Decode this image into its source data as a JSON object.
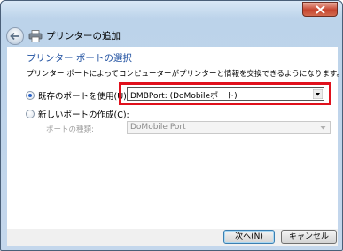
{
  "window": {
    "title": "プリンターの追加",
    "colors": {
      "heading": "#1e4fa0",
      "highlight": "#e0101c",
      "titlebar": "#bcd3ea"
    }
  },
  "page": {
    "heading": "プリンター ポートの選択",
    "description": "プリンター ポートによってコンピューターがプリンターと情報を交換できるようになります。"
  },
  "options": {
    "use_existing": {
      "label": "既存のポートを使用(U):",
      "selected": true,
      "value": "DMBPort: (DoMobileポート)"
    },
    "create_new": {
      "label": "新しいポートの作成(C):",
      "selected": false
    },
    "port_type": {
      "label": "ポートの種類:",
      "value": "DoMobile Port"
    }
  },
  "buttons": {
    "next": "次へ(N)",
    "cancel": "キャンセル"
  },
  "icons": [
    "close-icon",
    "back-arrow-icon",
    "printer-icon",
    "dropdown-arrow-icon"
  ]
}
